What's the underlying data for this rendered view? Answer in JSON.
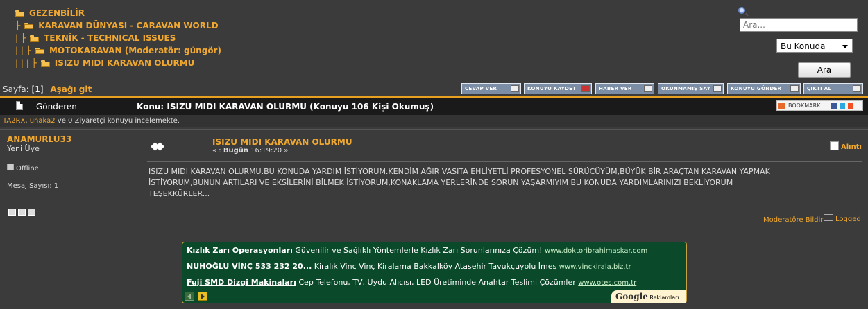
{
  "breadcrumb": {
    "items": [
      {
        "prefix": "",
        "label": "GEZENBİLİR"
      },
      {
        "prefix": "├",
        "label": "KARAVAN DÜNYASI - CARAVAN WORLD"
      },
      {
        "prefix": "| ├",
        "label": "TEKNİK - TECHNICAL ISSUES"
      },
      {
        "prefix": "| | ├",
        "label": "MOTOKARAVAN (Moderatör: güngör)"
      },
      {
        "prefix": "| | | ├",
        "label": "ISIZU MIDI KARAVAN OLURMU"
      }
    ]
  },
  "search": {
    "placeholder": "Ara...",
    "scope": "Bu Konuda",
    "button": "Ara"
  },
  "pagination": {
    "label": "Sayfa:",
    "current": "[1]",
    "go_down": "Aşağı git"
  },
  "toolbar": [
    "CEVAP VER",
    "KONUYU KAYDET",
    "HABER VER",
    "OKUNMAMIŞ SAY",
    "KONUYU GÖNDER",
    "ÇIKTI AL"
  ],
  "header": {
    "author_col": "Gönderen",
    "topic": "Konu: ISIZU MIDI KARAVAN OLURMU  (Konuyu 106 Kişi Okumuş)",
    "bookmark": "BOOKMARK"
  },
  "viewers": {
    "user1": "TA2RX",
    "user2": "unaka2",
    "rest": " ve 0 Ziyaretçi konuyu incelemekte."
  },
  "post": {
    "author": "ANAMURLU33",
    "rank": "Yeni Üye",
    "status": "Offline",
    "message_count": "Mesaj Sayısı: 1",
    "title": "ISIZU MIDI KARAVAN OLURMU",
    "date_prefix": "« : ",
    "date_day": "Bugün",
    "date_time": " 16:19:20 »",
    "quote": "Alıntı",
    "body_line1": "ISIZU MIDI KARAVAN OLURMU.BU KONUDA YARDIM İSTİYORUM.KENDİM AĞIR VASITA EHLİYETLİ PROFESYONEL SÜRÜCÜYÜM,BÜYÜK BİR ARAÇTAN KARAVAN YAPMAK",
    "body_line2": "İSTİYORUM,BUNUN ARTILARI VE EKSİLERİNİ  BİLMEK İSTİYORUM,KONAKLAMA YERLERİNDE SORUN YAŞARMIYIM BU KONUDA YARDIMLARINIZI BEKLİYORUM",
    "body_line3": " TEŞEKKÜRLER...",
    "report": "Moderatöre Bildir",
    "logged": "Logged"
  },
  "ads": [
    {
      "title": "Kızlık Zarı Operasyonları",
      "text": " Güvenilir ve Sağlıklı Yöntemlerle Kızlık Zarı Sorunlarınıza Çözüm! ",
      "url": "www.doktoribrahimaskar.com"
    },
    {
      "title": "NUHOĞLU VİNÇ 533 232 20...",
      "text": " Kiralık Vinç Vinç Kiralama Bakkalköy Ataşehir Tavukçuyolu İmes ",
      "url": "www.vinckirala.biz.tr"
    },
    {
      "title": "Fuji SMD Dizgi Makinaları",
      "text": " Cep Telefonu, TV, Uydu Alıcısı, LED Üretiminde Anahtar Teslimi Çözümler ",
      "url": "www.otes.com.tr"
    }
  ],
  "google": {
    "brand": "Google",
    "label": " Reklamları"
  }
}
